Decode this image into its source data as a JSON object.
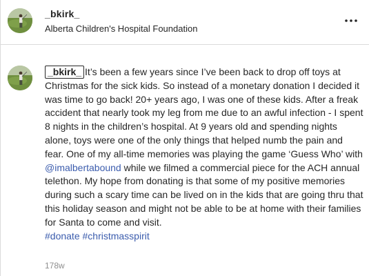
{
  "post": {
    "header": {
      "username": "_bkirk_",
      "location": "Alberta Children's Hospital Foundation"
    },
    "caption": {
      "username": "_bkirk_",
      "text_1": "It’s been a few years since I’ve been back to drop off toys at Christmas for the sick kids. So instead of a monetary donation I decided it was time to go back! 20+ years ago, I was one of these kids. After a freak accident that nearly took my leg from me due to an awful infection - I spent 8 nights in the children’s hospital. At 9 years old and spending nights alone, toys were one of the only things that helped numb the pain and fear. One of my all-time memories was playing the game ‘Guess Who’ with ",
      "mention": "@imalbertabound",
      "text_2": " while we filmed a commercial piece for the ACH annual telethon. My hope from donating is that some of my positive memories during such a scary time can be lived on in the kids that are going thru that this holiday season and might not be able to be at home with their families for Santa to come and visit.",
      "hashtag_1": "#donate",
      "hashtag_2": "#christmasspirit"
    },
    "timestamp": "178w"
  },
  "icons": {
    "more": "more-horizontal-icon",
    "avatar": "profile-photo-golfer"
  },
  "colors": {
    "text": "#262626",
    "link": "#3b5cad",
    "muted": "#8e8e8e",
    "divider": "#dbdbdb"
  }
}
